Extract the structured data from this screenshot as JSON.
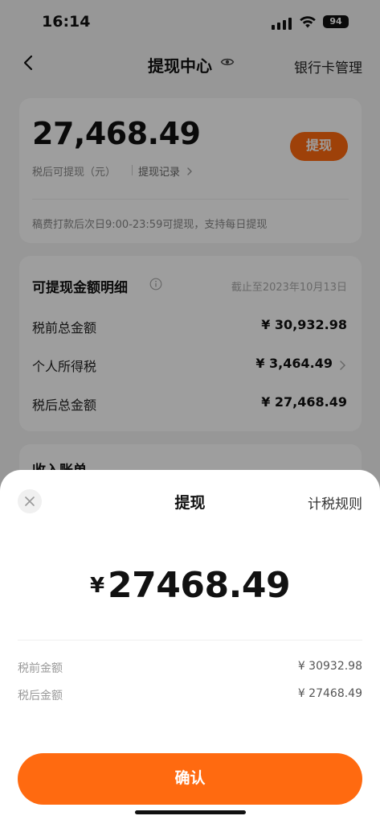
{
  "status_bar": {
    "time": "16:14",
    "battery": "94"
  },
  "nav": {
    "title": "提现中心",
    "right_link": "银行卡管理"
  },
  "balance_card": {
    "amount": "27,468.49",
    "sub_label": "税后可提现（元）",
    "record_link": "提现记录",
    "withdraw_button": "提现",
    "note": "稿费打款后次日9:00-23:59可提现，支持每日提现"
  },
  "detail_card": {
    "title": "可提现金额明细",
    "date": "截止至2023年10月13日",
    "rows": [
      {
        "label": "税前总金额",
        "value": "¥ 30,932.98"
      },
      {
        "label": "个人所得税",
        "value": "¥ 3,464.49"
      },
      {
        "label": "税后总金额",
        "value": "¥ 27,468.49"
      }
    ]
  },
  "income_card": {
    "title": "收入账单"
  },
  "sheet": {
    "title": "提现",
    "rules_link": "计税规则",
    "currency": "¥",
    "amount": "27468.49",
    "rows": [
      {
        "label": "税前金额",
        "value": "¥ 30932.98"
      },
      {
        "label": "税后金额",
        "value": "¥ 27468.49"
      }
    ],
    "confirm_button": "确认"
  },
  "colors": {
    "accent": "#ff6a10"
  },
  "icons": [
    "back-icon",
    "eye-icon",
    "chevron-right-icon",
    "info-icon",
    "close-icon",
    "wifi-icon",
    "signal-icon",
    "battery-icon"
  ]
}
